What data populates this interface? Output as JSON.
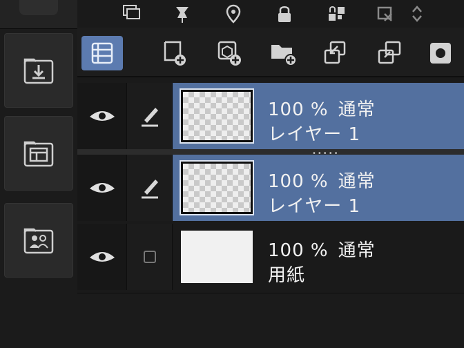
{
  "dock": {
    "buttons": [
      {
        "icon": "import-folder-icon"
      },
      {
        "icon": "layout-folder-icon"
      },
      {
        "icon": "people-folder-icon"
      }
    ]
  },
  "top_tools": [
    {
      "icon": "layer-stack-icon"
    },
    {
      "icon": "pin-icon"
    },
    {
      "icon": "reference-icon"
    },
    {
      "icon": "lock-icon"
    },
    {
      "icon": "lock-transparency-icon"
    },
    {
      "icon": "clip-mask-icon"
    },
    {
      "icon": "arrows-icon"
    }
  ],
  "second_tools": [
    {
      "icon": "layer-panel-icon",
      "active": true
    },
    {
      "icon": "new-raster-layer-icon"
    },
    {
      "icon": "new-vector-layer-icon"
    },
    {
      "icon": "new-folder-icon"
    },
    {
      "icon": "transfer-down-icon"
    },
    {
      "icon": "combine-icon"
    },
    {
      "icon": "mask-icon"
    }
  ],
  "layers": [
    {
      "opacity": "100 %",
      "mode": "通常",
      "name": "レイヤー 1",
      "selected": true,
      "visible": true,
      "editable": true
    },
    {
      "opacity": "100 %",
      "mode": "通常",
      "name": "レイヤー 1",
      "selected": true,
      "visible": true,
      "editable": true
    },
    {
      "opacity": "100 %",
      "mode": "通常",
      "name": "用紙",
      "selected": false,
      "visible": true,
      "editable": false
    }
  ],
  "colors": {
    "selection": "#53709f",
    "active_tool": "#5c7bb0",
    "panel": "#1a1a1a"
  }
}
